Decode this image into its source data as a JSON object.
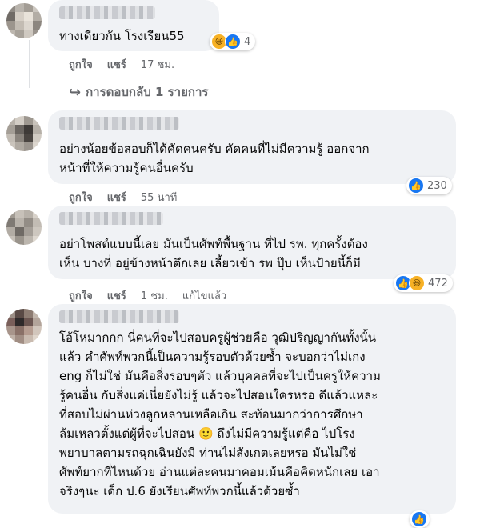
{
  "comments": [
    {
      "text_lines": [
        "ทางเดียวกัน โรงเรียน55"
      ],
      "like_label": "ถูกใจ",
      "reply_label": "แชร์",
      "time": "17 ชม.",
      "reaction_count": "4",
      "reaction_icons": [
        "haha-icon",
        "like-icon"
      ],
      "replies_label": "การตอบกลับ 1 รายการ"
    },
    {
      "text_lines": [
        "อย่างน้อยข้อสอบก็ได้คัดคนครับ คัดคนที่ไม่มีความรู้ ออกจาก",
        "หน้าที่ให้ความรู้คนอื่นครับ"
      ],
      "like_label": "ถูกใจ",
      "reply_label": "แชร์",
      "time": "55 นาที",
      "reaction_count": "230",
      "reaction_icons": [
        "like-icon"
      ]
    },
    {
      "text_lines": [
        "อย่าโพสต์แบบนี้เลย มันเป็นศัพท์พื้นฐาน ที่ไป รพ. ทุกครั้งต้อง",
        "เห็น บางที่ อยู่ข้างหน้าตึกเลย เลี้ยวเข้า รพ ปุ๊บ เห็นป้ายนี้ก็มี"
      ],
      "like_label": "ถูกใจ",
      "reply_label": "แชร์",
      "time": "1 ชม.",
      "edited_label": "แก้ไขแล้ว",
      "reaction_count": "472",
      "reaction_icons": [
        "like-icon",
        "haha-icon"
      ]
    },
    {
      "text_lines": [
        "โอ้โหมากกก นี่คนที่จะไปสอบครูผู้ช่วยคือ วุฒิปริญญากันทั้งนั้น",
        "แล้ว คำศัพท์พวกนี้เป็นความรู้รอบตัวด้วยซ้ำ จะบอกว่าไม่เก่ง",
        "eng ก็ไม่ใช่ มันคือสิ่งรอบๆตัว แล้วบุคคลที่จะไปเป็นครูให้ความ",
        "รู้คนอื่น กับสิ่งแค่เนี่ยยังไม่รู้ แล้วจะไปสอนใครหรอ ดีแล้วแหละ",
        "ที่สอบไม่ผ่านห่วงลูกหลานเหลือเกิน สะท้อนมากว่าการศึกษา",
        "ล้มเหลวตั้งแต่ผู้ที่จะไปสอน 🙂 ถึงไม่มีความรู้แต่คือ ไปโรง",
        "พยาบาลตามรถฉุกเฉินยังมี ท่านไม่สังเกตเลยหรอ มันไม่ใช่",
        "ศัพท์ยากที่ไหนด้วย อ่านแต่ละคนมาคอมเม้นคือคิดหนักเลย เอา",
        "จริงๆนะ เด็ก ป.6 ยังเรียนศัพท์พวกนี้แล้วด้วยซ้ำ"
      ],
      "reaction_icons": [
        "like-icon"
      ]
    }
  ],
  "colors": {
    "bubble": "#f0f2f5",
    "meta": "#65676b",
    "like": "#1877f2",
    "haha": "#f7b125"
  }
}
